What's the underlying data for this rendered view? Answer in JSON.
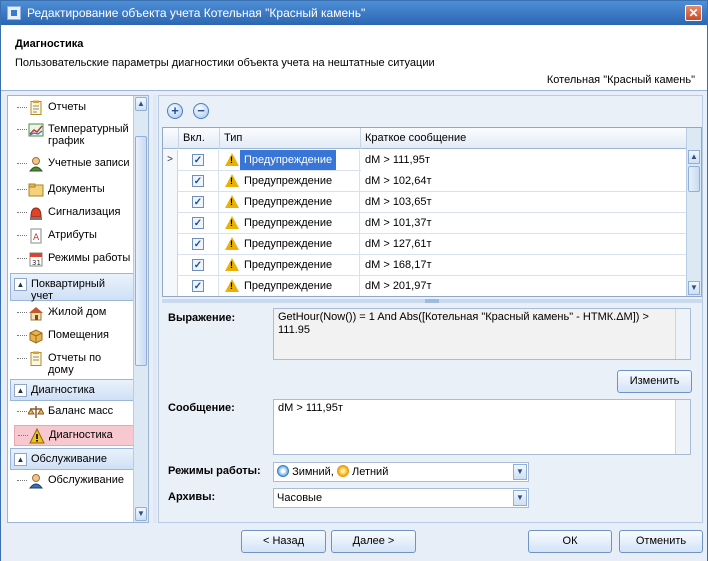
{
  "window": {
    "title": "Редактирование объекта учета Котельная \"Красный камень\"",
    "close_glyph": "✕"
  },
  "header": {
    "title": "Диагностика",
    "subtitle": "Пользовательские параметры диагностики объекта учета на нештатные ситуации",
    "object_name": "Котельная \"Красный камень\""
  },
  "sidebar": {
    "items": [
      {
        "label": "Отчеты",
        "icon": "report-icon"
      },
      {
        "label": "Температурный график",
        "icon": "chart-icon"
      },
      {
        "label": "Учетные записи",
        "icon": "user-icon"
      },
      {
        "label": "Документы",
        "icon": "folder-icon"
      },
      {
        "label": "Сигнализация",
        "icon": "alarm-icon"
      },
      {
        "label": "Атрибуты",
        "icon": "attributes-icon"
      },
      {
        "label": "Режимы работы",
        "icon": "calendar-icon"
      }
    ],
    "group_apartment": "Поквартирный учет",
    "apartment_items": [
      {
        "label": "Жилой дом",
        "icon": "house-icon"
      },
      {
        "label": "Помещения",
        "icon": "box-icon"
      },
      {
        "label": "Отчеты по дому",
        "icon": "report-icon"
      }
    ],
    "group_diagnostics": "Диагностика",
    "diagnostics_items": [
      {
        "label": "Баланс масс",
        "icon": "scales-icon"
      },
      {
        "label": "Диагностика",
        "icon": "warning-icon",
        "selected": true
      }
    ],
    "group_service": "Обслуживание",
    "service_items": [
      {
        "label": "Обслуживание",
        "icon": "service-user-icon"
      }
    ]
  },
  "toolbar": {
    "add_glyph": "+",
    "remove_glyph": "−"
  },
  "grid": {
    "columns": [
      "Вкл.",
      "Тип",
      "Краткое сообщение"
    ],
    "rows": [
      {
        "enabled": true,
        "type": "Предупреждение",
        "message": "dM > 111,95т",
        "selected": true
      },
      {
        "enabled": true,
        "type": "Предупреждение",
        "message": "dM > 102,64т"
      },
      {
        "enabled": true,
        "type": "Предупреждение",
        "message": "dM > 103,65т"
      },
      {
        "enabled": true,
        "type": "Предупреждение",
        "message": "dM > 101,37т"
      },
      {
        "enabled": true,
        "type": "Предупреждение",
        "message": "dM > 127,61т"
      },
      {
        "enabled": true,
        "type": "Предупреждение",
        "message": "dM > 168,17т"
      },
      {
        "enabled": true,
        "type": "Предупреждение",
        "message": "dM > 201,97т"
      }
    ]
  },
  "form": {
    "expression_label": "Выражение:",
    "expression_value": "GetHour(Now()) = 1 And Abs([Котельная \"Красный камень\" - НТМК.ΔM]) > 111.95",
    "change_button": "Изменить",
    "message_label": "Сообщение:",
    "message_value": "dM > 111,95т",
    "modes_label": "Режимы работы:",
    "modes_winter": "Зимний,",
    "modes_summer": "Летний",
    "archives_label": "Архивы:",
    "archives_value": "Часовые"
  },
  "footer": {
    "back": "< Назад",
    "next": "Далее >",
    "ok": "ОК",
    "cancel": "Отменить"
  }
}
